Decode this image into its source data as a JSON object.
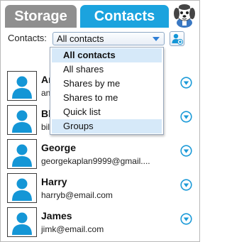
{
  "tabs": {
    "storage": "Storage",
    "contacts": "Contacts"
  },
  "filter": {
    "label": "Contacts:",
    "selected": "All contacts",
    "options": [
      "All contacts",
      "All shares",
      "Shares by me",
      "Shares to me",
      "Quick list",
      "Groups"
    ]
  },
  "contacts": [
    {
      "name": "An",
      "email": "an"
    },
    {
      "name": "Bl",
      "email": "bil"
    },
    {
      "name": "George",
      "email": "georgekaplan9999@gmail...."
    },
    {
      "name": "Harry",
      "email": "harryb@email.com"
    },
    {
      "name": "James",
      "email": "jimk@email.com"
    }
  ],
  "icons": {
    "mascot": "dog-mascot-icon",
    "add_contact": "add-contact-icon",
    "avatar": "person-silhouette-icon",
    "expand": "chevron-down-circle-icon",
    "dropdown_arrow": "triangle-down-icon"
  },
  "colors": {
    "active_tab": "#1ba3de",
    "inactive_tab": "#8f8f8f",
    "avatar_blue": "#1496d6",
    "highlight": "#d6e9f9"
  }
}
